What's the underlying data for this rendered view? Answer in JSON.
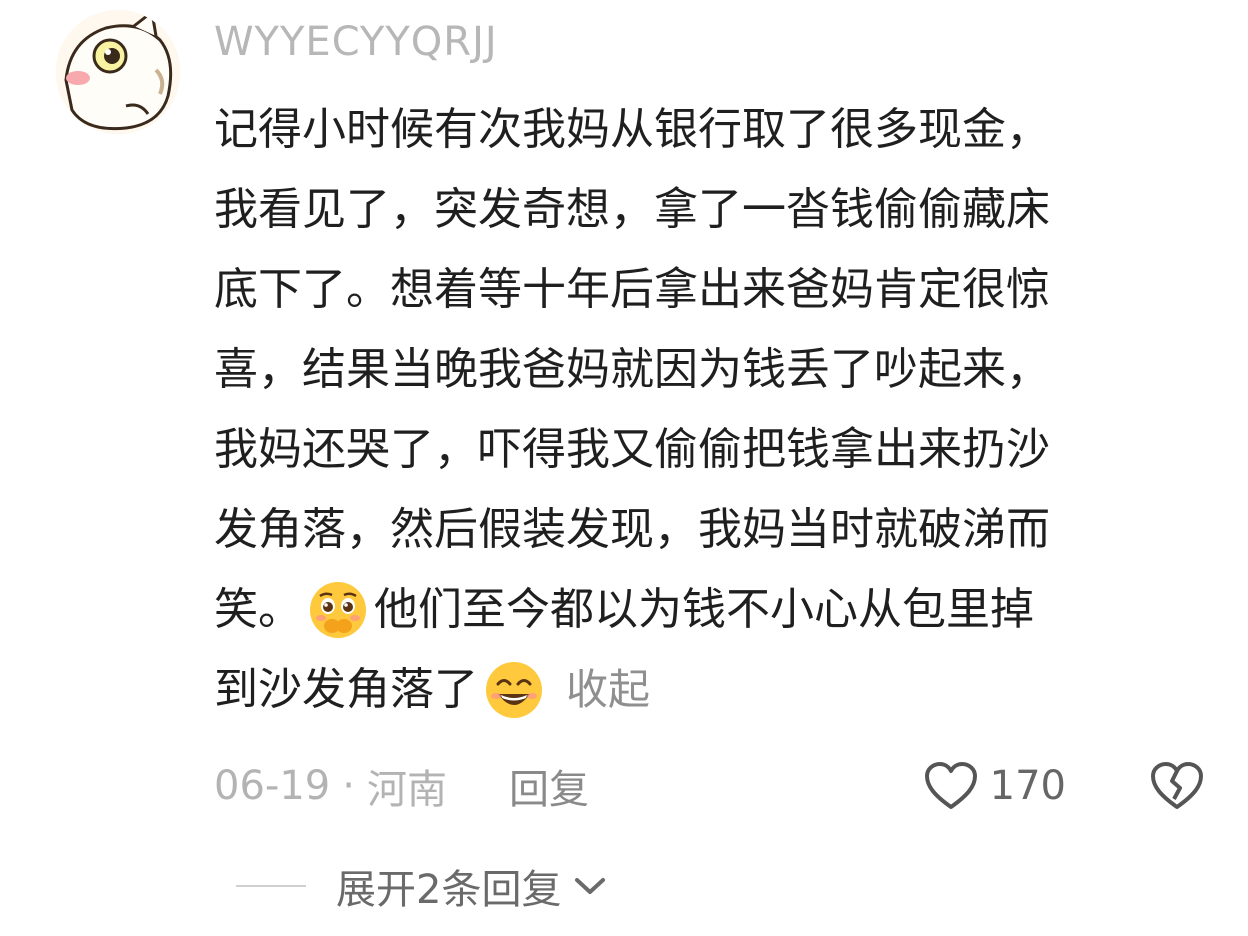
{
  "comment": {
    "username": "WYYECYYQRJJ",
    "avatar_icon": "cartoon-cat-avatar-icon",
    "lines": [
      "记得小时候有次我妈从银行取了很多现金，",
      "我看见了，突发奇想，拿了一沓钱偷偷藏床",
      "底下了。想着等十年后拿出来爸妈肯定很惊",
      "喜，结果当晚我爸妈就因为钱丢了吵起来，",
      "我妈还哭了，吓得我又偷偷把钱拿出来扔沙",
      "发角落，然后假装发现，我妈当时就破涕而"
    ],
    "line7_before_emoji": "笑。",
    "line7_emoji": "pleading-face-emoji",
    "line7_after_emoji": "他们至今都以为钱不小心从包里掉",
    "line8_before_emoji": "到沙发角落了",
    "line8_emoji": "grinning-face-emoji",
    "collapse_label": "收起",
    "date": "06-19",
    "separator": "·",
    "location": "河南",
    "reply_label": "回复",
    "like_icon": "heart-icon",
    "like_count": "170",
    "dislike_icon": "broken-heart-icon",
    "expand_label": "展开2条回复",
    "expand_icon": "chevron-down-icon"
  },
  "colors": {
    "text": "#1f1f1f",
    "muted": "#b3b3b3",
    "secondary": "#8a8a8a",
    "emoji_yellow": "#ffc93d"
  }
}
